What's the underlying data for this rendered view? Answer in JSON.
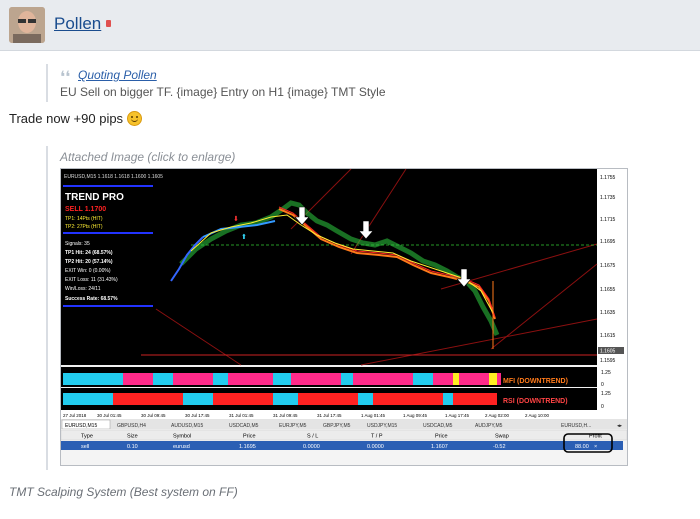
{
  "post": {
    "author": "Pollen",
    "quote": {
      "author_link": "Quoting Pollen",
      "text": "EU Sell on bigger TF. {image} Entry on H1 {image} TMT Style"
    },
    "message": "Trade now +90 pips",
    "attachment_label": "Attached Image (click to enlarge)",
    "signature": "TMT Scalping System (Best system on FF)"
  },
  "chart": {
    "header": "EURUSD,M15  1.1618 1.1618 1.1600 1.1605",
    "panel": {
      "title": "TREND PRO",
      "signal": "SELL 1.1700",
      "tp1": "TP1: 14Pts (HIT)",
      "tp2": "TP2: 27Pts (HIT)",
      "signals": "Signals: 35",
      "tp1_hit": "TP1 Hit: 24 (68.57%)",
      "tp2_hit": "TP2 Hit: 20 (57.14%)",
      "exit_win": "EXIT Win: 0 (0.00%)",
      "exit_loss": "EXIT Loss: 11 (31.43%)",
      "winloss": "Win/Loss: 24/11",
      "success": "Success Rate: 68.57%"
    },
    "price_axis": [
      "1.1755",
      "1.1735",
      "1.1715",
      "1.1695",
      "1.1675",
      "1.1655",
      "1.1635",
      "1.1615",
      "1.1605",
      "1.1595"
    ],
    "mfi_label": "MFI (DOWNTREND)",
    "rsi_label": "RSI (DOWNTREND)",
    "sub_axis": [
      "1.25",
      "0",
      "1.25",
      "0"
    ],
    "time_axis": [
      "27 Jul 2018",
      "30 Jul 01:45",
      "30 Jul 09:45",
      "30 Jul 17:45",
      "31 Jul 01:45",
      "31 Jul 09:45",
      "31 Jul 17:45",
      "1 Aug 01:45",
      "1 Aug 09:45",
      "1 Aug 17:45",
      "2 Aug 02:00",
      "2 Aug 10:00"
    ],
    "symbol_tabs": [
      "EURUSD,M15",
      "GBPUSD,H4",
      "AUDUSD,M15",
      "USDCAD,M5",
      "EURJPY,M5",
      "GBPJPY,M5",
      "USDJPY,M15",
      "USDCAD,M5",
      "AUDJPY,M5",
      "EURUSD,H..."
    ],
    "trade_table": {
      "columns": [
        "Type",
        "Size",
        "Symbol",
        "Price",
        "S / L",
        "T / P",
        "Price",
        "Swap",
        "Profit"
      ],
      "row": [
        "sell",
        "0.10",
        "eurusd",
        "1.1695",
        "0.0000",
        "0.0000",
        "1.1607",
        "-0.52",
        "88.00"
      ]
    }
  }
}
